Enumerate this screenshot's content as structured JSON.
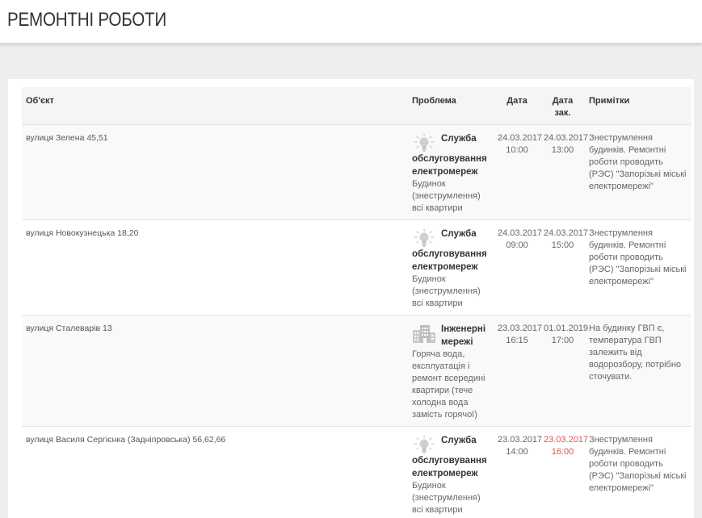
{
  "page": {
    "title": "РЕМОНТНІ РОБОТИ"
  },
  "table": {
    "headers": {
      "object": "Об'єкт",
      "problem": "Проблема",
      "date": "Дата",
      "date_closed": "Дата зак.",
      "notes": "Примітки"
    },
    "rows": [
      {
        "object": "вулиця Зелена 45,51",
        "icon": "lightbulb-icon",
        "service": "Служба обслуговування електромереж",
        "description": "Будинок (знеструмлення) всі квартири",
        "date": "24.03.2017 10:00",
        "date_closed": "24.03.2017 13:00",
        "overdue": false,
        "notes": "Знеструмлення будинків. Ремонтні роботи проводить (РЭС) \"Запорізькі міські електромережі\""
      },
      {
        "object": "вулиця Новокузнецька 18,20",
        "icon": "lightbulb-icon",
        "service": "Служба обслуговування електромереж",
        "description": "Будинок (знеструмлення) всі квартири",
        "date": "24.03.2017 09:00",
        "date_closed": "24.03.2017 15:00",
        "overdue": false,
        "notes": "Знеструмлення будинків. Ремонтні роботи проводить (РЭС) \"Запорізькі міські електромережі\""
      },
      {
        "object": "вулиця Сталеварів 13",
        "icon": "building-icon",
        "service": "Інженерні мережі",
        "description": "Горяча вода, експлуатація і ремонт всередині квартири (тече холодна вода замість горячої)",
        "date": "23.03.2017 16:15",
        "date_closed": "01.01.2019 17:00",
        "overdue": false,
        "notes": "На будинку ГВП є, температура ГВП залежить від водорозбору, потрібно сточувати."
      },
      {
        "object": "вулиця Василя Сергієнка (Задніпровська) 56,62,66",
        "icon": "lightbulb-icon",
        "service": "Служба обслуговування електромереж",
        "description": "Будинок (знеструмлення) всі квартири",
        "date": "23.03.2017 14:00",
        "date_closed": "23.03.2017 16:00",
        "overdue": true,
        "notes": "Знеструмлення будинків. Ремонтні роботи проводить (РЭС) \"Запорізькі міські електромережі\""
      }
    ]
  },
  "colors": {
    "overdue": "#d9534f",
    "background": "#eeeeee"
  }
}
